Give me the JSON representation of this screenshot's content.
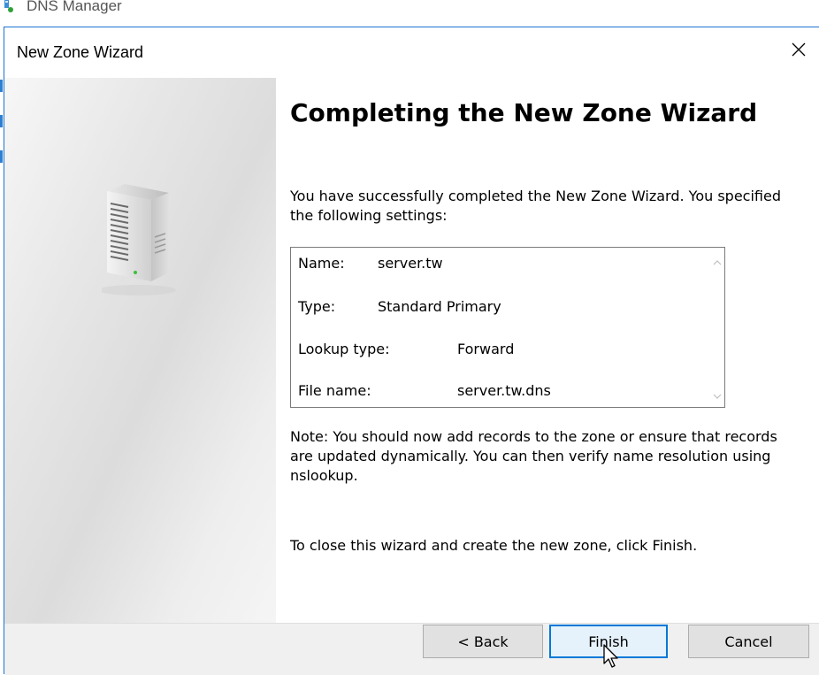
{
  "background_app": {
    "title": "DNS Manager"
  },
  "dialog": {
    "title": "New Zone Wizard",
    "heading": "Completing the New Zone Wizard",
    "intro": "You have successfully completed the New Zone Wizard. You specified the following settings:",
    "settings": [
      {
        "label": "Name:",
        "value": "server.tw"
      },
      {
        "label": "Type:",
        "value": "Standard Primary"
      },
      {
        "label": "Lookup type:",
        "value": "Forward"
      },
      {
        "label": "File name:",
        "value": "server.tw.dns"
      }
    ],
    "note": "Note: You should now add records to the zone or ensure that records are updated dynamically. You can then verify name resolution using nslookup.",
    "closing": "To close this wizard and create the new zone, click Finish.",
    "buttons": {
      "back": "< Back",
      "finish": "Finish",
      "cancel": "Cancel"
    }
  },
  "colors": {
    "accent": "#0078d7",
    "window_border": "#1b74d0",
    "footer": "#f0f0f0"
  }
}
